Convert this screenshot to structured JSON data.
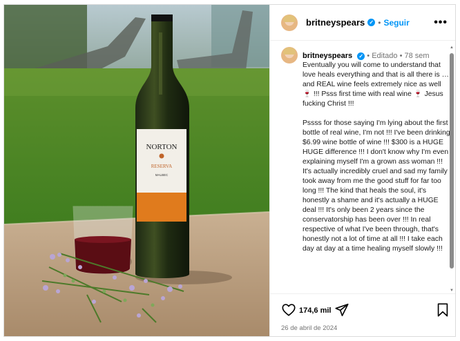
{
  "post": {
    "username": "britneyspears",
    "follow_label": "Seguir",
    "more_label": "•••",
    "separator": "•"
  },
  "photo": {
    "bottle_brand": "NORTON",
    "bottle_line": "RESERVA",
    "bottle_variety": "MALBEC"
  },
  "caption": {
    "username": "britneyspears",
    "edited_label": "Editado",
    "age": "78 sem",
    "paragraph_1": "Eventually you will come to understand that love heals everything and that is all there is … and REAL wine feels extremely nice as well 🍷 !!! Psss first time with real wine 🍷 Jesus fucking Christ !!!",
    "paragraph_2": "Pssss for those saying I'm lying about the first bottle of real wine, I'm not !!! I've been drinking $6.99 wine bottle of wine !!! $300 is a HUGE HUGE difference !!! I don't know why I'm even explaining myself I'm a grown ass woman !!! It's actually incredibly cruel and sad my family took away from me the good stuff for far too long !!! The kind that heals the soul, it's honestly a shame and it's actually a HUGE deal !!! It's only been 2 years since the conservatorship has been over !!! In real respective of what I've been through, that's honestly not a lot of time at all !!! I take each day at day at a time healing myself slowly !!!"
  },
  "actions": {
    "likes": "174,6 mil",
    "date": "26 de abril de 2024"
  },
  "scrollbar": {
    "up": "▲",
    "down": "▼"
  },
  "colors": {
    "accent": "#0095f6",
    "muted": "#737373",
    "border": "#dbdbdb"
  },
  "icons": [
    "verified-icon",
    "more-icon",
    "heart-icon",
    "share-icon",
    "bookmark-icon"
  ]
}
